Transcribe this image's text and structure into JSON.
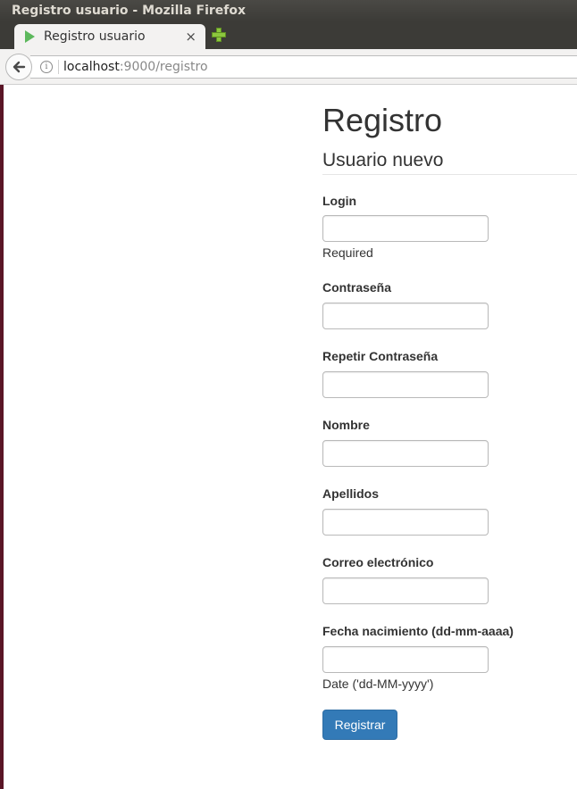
{
  "window": {
    "title": "Registro usuario - Mozilla Firefox"
  },
  "tab": {
    "title": "Registro usuario",
    "close_glyph": "×",
    "favicon": "play-triangle-icon"
  },
  "navbar": {
    "back_icon": "back-arrow-icon",
    "info_icon": "info-icon",
    "url_host": "localhost",
    "url_rest": ":9000/registro"
  },
  "page": {
    "title": "Registro",
    "subtitle": "Usuario nuevo",
    "fields": [
      {
        "label": "Login",
        "value": "",
        "help": "Required"
      },
      {
        "label": "Contraseña",
        "value": ""
      },
      {
        "label": "Repetir Contraseña",
        "value": ""
      },
      {
        "label": "Nombre",
        "value": ""
      },
      {
        "label": "Apellidos",
        "value": ""
      },
      {
        "label": "Correo electrónico",
        "value": ""
      },
      {
        "label": "Fecha nacimiento (dd-mm-aaaa)",
        "value": "",
        "help": "Date ('dd-MM-yyyy')"
      }
    ],
    "submit_label": "Registrar"
  },
  "colors": {
    "titlebar": "#3c3b37",
    "primary_button": "#337ab7",
    "favicon": "#5cb85c",
    "new_tab": "#8cc63e"
  }
}
